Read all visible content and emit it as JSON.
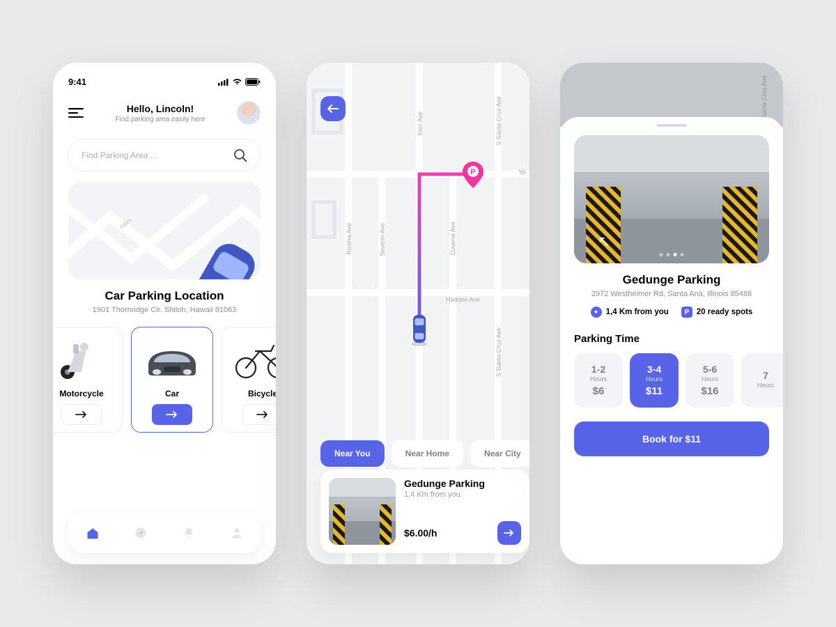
{
  "colors": {
    "accent": "#5764e8",
    "muted": "#8a8f99"
  },
  "status": {
    "time": "9:41"
  },
  "home": {
    "greeting_title": "Hello, Lincoln!",
    "greeting_sub": "Find parking area easily here",
    "search_placeholder": "Find Parking Area ...",
    "map_label": "Arbor",
    "location_title": "Car Parking Location",
    "location_addr": "1901 Thornridge Cir. Shiloh, Hawaii 81063",
    "vehicles": [
      {
        "label": "Motorcycle",
        "selected": false
      },
      {
        "label": "Car",
        "selected": true
      },
      {
        "label": "Bicycle",
        "selected": false
      }
    ]
  },
  "map": {
    "streets": {
      "rosina": "Rosina Ave",
      "severin": "Severin Ave",
      "covena": "Covena Ave",
      "kerr": "Kerr Ave",
      "santa_cruz": "S Santa Cruz Ave",
      "haddon": "Haddon Ave",
      "yo": "Yo"
    },
    "filters": [
      {
        "label": "Near You",
        "active": true
      },
      {
        "label": "Near Home",
        "active": false
      },
      {
        "label": "Near City",
        "active": false
      }
    ],
    "result": {
      "title": "Gedunge Parking",
      "distance": "1,4 Km from you",
      "price": "$6.00/h"
    }
  },
  "detail": {
    "title": "Gedunge Parking",
    "addr": "2972 Westheimer Rd. Santa Ana, Illinois 85486",
    "distance": "1,4 Km from you",
    "spots": "20 ready spots",
    "section_heading": "Parking Time",
    "map_street": "S Santa Cruz Ave",
    "times": [
      {
        "range": "1-2",
        "unit": "Hours",
        "price": "$6",
        "selected": false
      },
      {
        "range": "3-4",
        "unit": "Hours",
        "price": "$11",
        "selected": true
      },
      {
        "range": "5-6",
        "unit": "Hours",
        "price": "$16",
        "selected": false
      },
      {
        "range": "7",
        "unit": "Hours",
        "price": "",
        "selected": false
      }
    ],
    "book_label": "Book for $11"
  }
}
